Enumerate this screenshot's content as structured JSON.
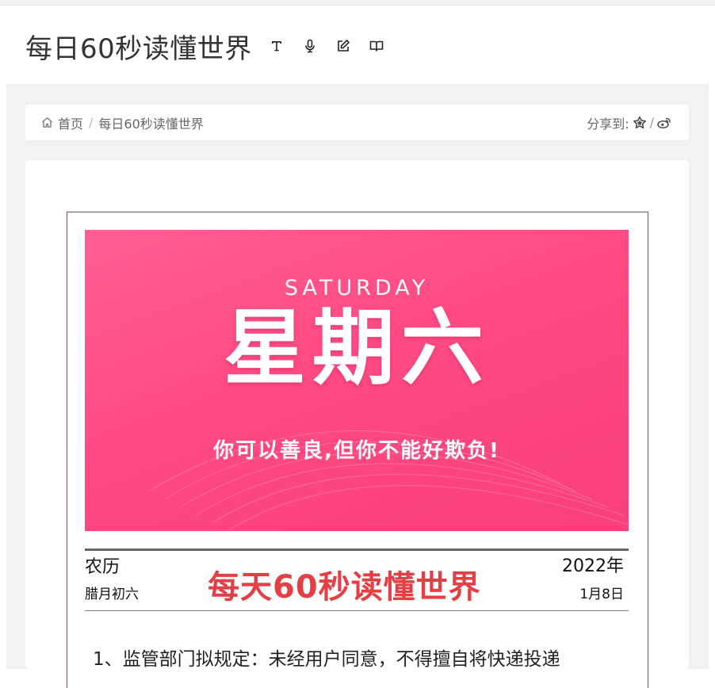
{
  "header": {
    "title": "每日60秒读懂世界",
    "tools": [
      {
        "icon": "text-size-icon"
      },
      {
        "icon": "microphone-icon"
      },
      {
        "icon": "edit-icon"
      },
      {
        "icon": "book-icon"
      }
    ]
  },
  "breadcrumb": {
    "home_icon": "home-icon",
    "home": "首页",
    "separator": "/",
    "current": "每日60秒读懂世界"
  },
  "share": {
    "label": "分享到:",
    "separator": "/",
    "icons": [
      "star-icon",
      "weibo-icon"
    ]
  },
  "banner": {
    "english_day": "SATURDAY",
    "chinese_day": "星期六",
    "motto": "你可以善良,但你不能好欺负!",
    "colors": {
      "start": "#ff5f93",
      "end": "#f8407a"
    }
  },
  "masthead": {
    "lunar_label": "农历",
    "lunar_date": "腊月初六",
    "brand": "每天60秒读懂世界",
    "year": "2022年",
    "date": "1月8日",
    "brand_color": "#e53f46"
  },
  "news": {
    "item1": "1、监管部门拟规定：未经用户同意，不得擅自将快递投递"
  }
}
